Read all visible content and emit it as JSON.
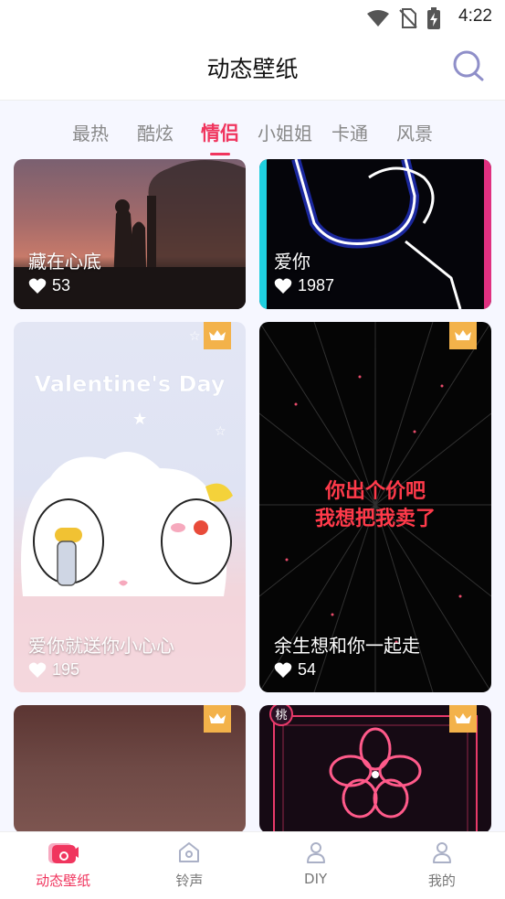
{
  "status_bar": {
    "time": "4:22"
  },
  "header": {
    "title": "动态壁纸"
  },
  "tabs": [
    {
      "label": "最热"
    },
    {
      "label": "酷炫"
    },
    {
      "label": "情侣"
    },
    {
      "label": "小姐姐"
    },
    {
      "label": "卡通"
    },
    {
      "label": "风景"
    }
  ],
  "active_tab": "情侣",
  "cards": [
    {
      "title": "藏在心底",
      "likes": "53",
      "vip": false
    },
    {
      "title": "爱你",
      "likes": "1987",
      "vip": false
    },
    {
      "title": "爱你就送你小心心",
      "likes": "195",
      "vip": true,
      "art_text": "Valentine's Day"
    },
    {
      "title": "余生想和你一起走",
      "likes": "54",
      "vip": true,
      "art_text_1": "你出个价吧",
      "art_text_2": "我想把我卖了"
    },
    {
      "title": "",
      "likes": "",
      "vip": true
    },
    {
      "title": "",
      "likes": "",
      "vip": true,
      "art_text": "桃"
    }
  ],
  "bottom_nav": [
    {
      "label": "动态壁纸",
      "icon": "video-wallpaper-icon",
      "active": true
    },
    {
      "label": "铃声",
      "icon": "home-bell-icon",
      "active": false
    },
    {
      "label": "DIY",
      "icon": "person-icon",
      "active": false
    },
    {
      "label": "我的",
      "icon": "person-icon",
      "active": false
    }
  ],
  "colors": {
    "accent": "#f0355e",
    "vip_badge": "#f3b24a",
    "tab_bg": "#f6f7ff"
  }
}
